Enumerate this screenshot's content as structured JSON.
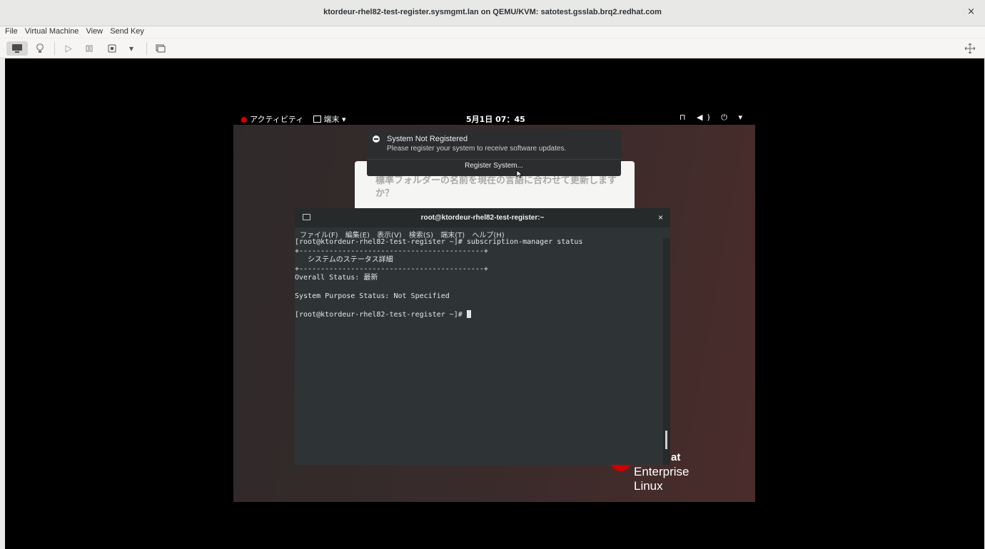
{
  "window": {
    "title": "ktordeur-rhel82-test-register.sysmgmt.lan on QEMU/KVM: satotest.gsslab.brq2.redhat.com",
    "close_label": "×"
  },
  "menu": {
    "items": [
      "File",
      "Virtual Machine",
      "View",
      "Send Key"
    ]
  },
  "toolbar": {
    "dropdown_label": "▾",
    "fullscreen_label": "⇲"
  },
  "gnome": {
    "activities": "アクティビティ",
    "terminal_menu": "端末 ▾",
    "clock": "5月1日 07：45",
    "status_icons": "⊓ ◀) ⏻ ▾"
  },
  "notification": {
    "title": "System Not Registered",
    "body": "Please register your system to receive software updates.",
    "button": "Register System..."
  },
  "dialog": {
    "question": "標準フォルダーの名前を現在の言語に合わせて更新しますか？"
  },
  "brand": {
    "line1": "at",
    "line2": "Enterprise Linux"
  },
  "terminal": {
    "title": "root@ktordeur-rhel82-test-register:~",
    "close_label": "×",
    "menu": [
      "ファイル(F)",
      "編集(E)",
      "表示(V)",
      "検索(S)",
      "端末(T)",
      "ヘルプ(H)"
    ],
    "lines": {
      "l1": "[root@ktordeur-rhel82-test-register ~]# subscription-manager status",
      "l2": "+-------------------------------------------+",
      "l3": "   システムのステータス詳細",
      "l4": "+-------------------------------------------+",
      "l5": "Overall Status: 最新",
      "l6": "",
      "l7": "System Purpose Status: Not Specified",
      "l8": "",
      "prompt": "[root@ktordeur-rhel82-test-register ~]# "
    }
  }
}
